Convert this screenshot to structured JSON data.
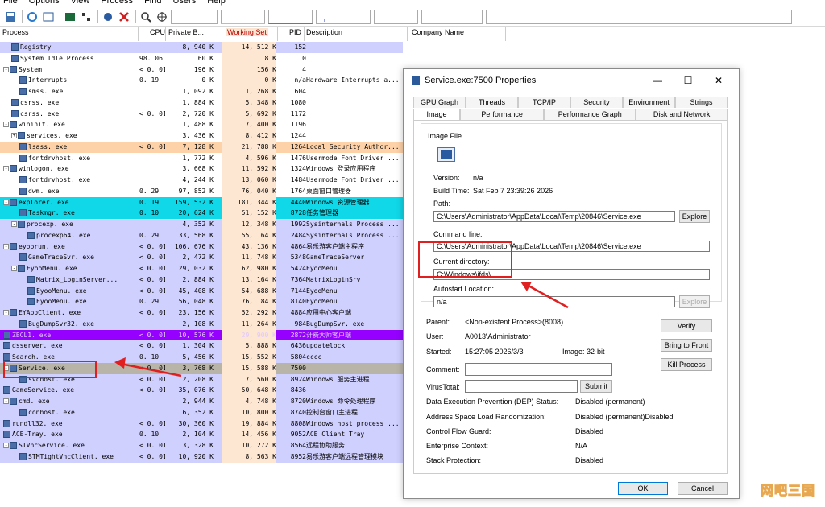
{
  "menu": [
    "File",
    "Options",
    "View",
    "Process",
    "Find",
    "Users",
    "Help"
  ],
  "columns": {
    "process": "Process",
    "cpu": "CPU",
    "private": "Private B...",
    "working": "Working Set",
    "pid": "PID",
    "description": "Description",
    "company": "Company Name"
  },
  "rows": [
    {
      "name": "Registry",
      "cpu": "",
      "pb": "8, 940 K",
      "ws": "14, 512 K",
      "pid": "152",
      "desc": "",
      "bg": "purple",
      "indent": 1
    },
    {
      "name": "System Idle Process",
      "cpu": "98. 06",
      "pb": "60 K",
      "ws": "8 K",
      "pid": "0",
      "desc": "",
      "bg": "",
      "indent": 1
    },
    {
      "name": "System",
      "cpu": "< 0. 01",
      "pb": "196 K",
      "ws": "156 K",
      "pid": "4",
      "desc": "",
      "bg": "",
      "indent": 0,
      "exp": "-"
    },
    {
      "name": "Interrupts",
      "cpu": "0. 19",
      "pb": "0 K",
      "ws": "0 K",
      "pid": "n/a",
      "desc": "Hardware Interrupts a...",
      "bg": "",
      "indent": 2
    },
    {
      "name": "smss. exe",
      "cpu": "",
      "pb": "1, 092 K",
      "ws": "1, 268 K",
      "pid": "604",
      "desc": "",
      "bg": "",
      "indent": 2
    },
    {
      "name": "csrss. exe",
      "cpu": "",
      "pb": "1, 884 K",
      "ws": "5, 348 K",
      "pid": "1080",
      "desc": "",
      "bg": "",
      "indent": 1
    },
    {
      "name": "csrss. exe",
      "cpu": "< 0. 01",
      "pb": "2, 720 K",
      "ws": "5, 692 K",
      "pid": "1172",
      "desc": "",
      "bg": "",
      "indent": 1
    },
    {
      "name": "wininit. exe",
      "cpu": "",
      "pb": "1, 488 K",
      "ws": "7, 400 K",
      "pid": "1196",
      "desc": "",
      "bg": "",
      "indent": 0,
      "exp": "-"
    },
    {
      "name": "services. exe",
      "cpu": "",
      "pb": "3, 436 K",
      "ws": "8, 412 K",
      "pid": "1244",
      "desc": "",
      "bg": "",
      "indent": 1,
      "exp": "+"
    },
    {
      "name": "lsass. exe",
      "cpu": "< 0. 01",
      "pb": "7, 128 K",
      "ws": "21, 788 K",
      "pid": "1264",
      "desc": "Local Security Author...",
      "bg": "orange",
      "indent": 2
    },
    {
      "name": "fontdrvhost. exe",
      "cpu": "",
      "pb": "1, 772 K",
      "ws": "4, 596 K",
      "pid": "1476",
      "desc": "Usermode Font Driver ...",
      "bg": "",
      "indent": 2
    },
    {
      "name": "winlogon. exe",
      "cpu": "",
      "pb": "3, 668 K",
      "ws": "11, 592 K",
      "pid": "1324",
      "desc": "Windows 登录应用程序",
      "bg": "",
      "indent": 0,
      "exp": "-"
    },
    {
      "name": "fontdrvhost. exe",
      "cpu": "",
      "pb": "4, 244 K",
      "ws": "13, 060 K",
      "pid": "1484",
      "desc": "Usermode Font Driver ...",
      "bg": "",
      "indent": 2
    },
    {
      "name": "dwm. exe",
      "cpu": "0. 29",
      "pb": "97, 852 K",
      "ws": "76, 040 K",
      "pid": "1764",
      "desc": "桌面窗口管理器",
      "bg": "",
      "indent": 2
    },
    {
      "name": "explorer. exe",
      "cpu": "0. 19",
      "pb": "159, 532 K",
      "ws": "181, 344 K",
      "pid": "4440",
      "desc": "Windows 资源管理器",
      "bg": "cyan",
      "indent": 0,
      "exp": "-"
    },
    {
      "name": "Taskmgr. exe",
      "cpu": "0. 10",
      "pb": "20, 624 K",
      "ws": "51, 152 K",
      "pid": "8728",
      "desc": "任务管理器",
      "bg": "cyan",
      "indent": 2
    },
    {
      "name": "procexp. exe",
      "cpu": "",
      "pb": "4, 352 K",
      "ws": "12, 348 K",
      "pid": "1992",
      "desc": "Sysinternals Process ...",
      "bg": "purple",
      "indent": 1,
      "exp": "-"
    },
    {
      "name": "procexp64. exe",
      "cpu": "0. 29",
      "pb": "33, 568 K",
      "ws": "55, 164 K",
      "pid": "2484",
      "desc": "Sysinternals Process ...",
      "bg": "purple",
      "indent": 3
    },
    {
      "name": "eyoorun. exe",
      "cpu": "< 0. 01",
      "pb": "106, 676 K",
      "ws": "43, 136 K",
      "pid": "4864",
      "desc": "易乐游客户端主程序",
      "bg": "purple",
      "indent": 0,
      "exp": "-"
    },
    {
      "name": "GameTraceSvr. exe",
      "cpu": "< 0. 01",
      "pb": "2, 472 K",
      "ws": "11, 748 K",
      "pid": "5348",
      "desc": "GameTraceServer",
      "bg": "purple",
      "indent": 2
    },
    {
      "name": "EyooMenu. exe",
      "cpu": "< 0. 01",
      "pb": "29, 032 K",
      "ws": "62, 980 K",
      "pid": "5424",
      "desc": "EyooMenu",
      "bg": "purple",
      "indent": 1,
      "exp": "-"
    },
    {
      "name": "Matrix_LoginServer...",
      "cpu": "< 0. 01",
      "pb": "2, 884 K",
      "ws": "13, 164 K",
      "pid": "7364",
      "desc": "MatrixLoginSrv",
      "bg": "purple",
      "indent": 3
    },
    {
      "name": "EyooMenu. exe",
      "cpu": "< 0. 01",
      "pb": "45, 408 K",
      "ws": "54, 688 K",
      "pid": "7144",
      "desc": "EyooMenu",
      "bg": "purple",
      "indent": 3
    },
    {
      "name": "EyooMenu. exe",
      "cpu": "0. 29",
      "pb": "56, 048 K",
      "ws": "76, 184 K",
      "pid": "8140",
      "desc": "EyooMenu",
      "bg": "purple",
      "indent": 3
    },
    {
      "name": "EYAppClient. exe",
      "cpu": "< 0. 01",
      "pb": "23, 156 K",
      "ws": "52, 292 K",
      "pid": "4884",
      "desc": "应用中心客户端",
      "bg": "purple",
      "indent": 0,
      "exp": "-"
    },
    {
      "name": "BugDumpSvr32. exe",
      "cpu": "",
      "pb": "2, 108 K",
      "ws": "11, 264 K",
      "pid": "984",
      "desc": "BugDumpSvr. exe",
      "bg": "purple",
      "indent": 2
    },
    {
      "name": "ZBCL1. exe",
      "cpu": "< 0. 01",
      "pb": "10, 576 K",
      "ws": "29, 900 K",
      "pid": "2872",
      "desc": "计费大师客户端",
      "bg": "violet",
      "indent": 0
    },
    {
      "name": "dsserver. exe",
      "cpu": "< 0. 01",
      "pb": "1, 304 K",
      "ws": "5, 888 K",
      "pid": "6436",
      "desc": "updatelock",
      "bg": "purple",
      "indent": 0
    },
    {
      "name": "Search. exe",
      "cpu": "0. 10",
      "pb": "5, 456 K",
      "ws": "15, 552 K",
      "pid": "5804",
      "desc": "cccc",
      "bg": "purple",
      "indent": 0
    },
    {
      "name": "Service. exe",
      "cpu": "< 0. 01",
      "pb": "3, 768 K",
      "ws": "15, 588 K",
      "pid": "7500",
      "desc": "",
      "bg": "gray",
      "indent": 0,
      "exp": "-"
    },
    {
      "name": "svchost. exe",
      "cpu": "< 0. 01",
      "pb": "2, 208 K",
      "ws": "7, 560 K",
      "pid": "8924",
      "desc": "Windows 服务主进程",
      "bg": "purple",
      "indent": 2
    },
    {
      "name": "GameService. exe",
      "cpu": "< 0. 01",
      "pb": "35, 076 K",
      "ws": "50, 648 K",
      "pid": "8436",
      "desc": "",
      "bg": "purple",
      "indent": 0
    },
    {
      "name": "cmd. exe",
      "cpu": "",
      "pb": "2, 944 K",
      "ws": "4, 748 K",
      "pid": "8720",
      "desc": "Windows 命令处理程序",
      "bg": "purple",
      "indent": 0,
      "exp": "-"
    },
    {
      "name": "conhost. exe",
      "cpu": "",
      "pb": "6, 352 K",
      "ws": "10, 800 K",
      "pid": "8740",
      "desc": "控制台窗口主进程",
      "bg": "purple",
      "indent": 2
    },
    {
      "name": "rundll32. exe",
      "cpu": "< 0. 01",
      "pb": "30, 360 K",
      "ws": "19, 884 K",
      "pid": "8808",
      "desc": "Windows host process ...",
      "bg": "purple",
      "indent": 0
    },
    {
      "name": "ACE-Tray. exe",
      "cpu": "0. 10",
      "pb": "2, 104 K",
      "ws": "14, 456 K",
      "pid": "9052",
      "desc": "ACE Client Tray",
      "bg": "purple",
      "indent": 0
    },
    {
      "name": "STVncService. exe",
      "cpu": "< 0. 01",
      "pb": "3, 328 K",
      "ws": "10, 272 K",
      "pid": "8564",
      "desc": "远程协助服务",
      "bg": "purple",
      "indent": 0,
      "exp": "-"
    },
    {
      "name": "STMTightVncClient. exe",
      "cpu": "< 0. 01",
      "pb": "10, 920 K",
      "ws": "8, 563 K",
      "pid": "8952",
      "desc": "易乐游客户端远程管理模块",
      "bg": "purple",
      "indent": 2
    }
  ],
  "dialog": {
    "title": "Service.exe:7500 Properties",
    "tabs_row1": [
      "GPU Graph",
      "Threads",
      "TCP/IP",
      "Security",
      "Environment",
      "Strings"
    ],
    "tabs_row2": [
      "Image",
      "Performance",
      "Performance Graph",
      "Disk and Network"
    ],
    "image_file_label": "Image File",
    "version_label": "Version:",
    "version_value": "n/a",
    "build_label": "Build Time:",
    "build_value": "Sat Feb  7 23:39:26 2026",
    "path_label": "Path:",
    "path_value": "C:\\Users\\Administrator\\AppData\\Local\\Temp\\20846\\Service.exe",
    "explore_label": "Explore",
    "cmdline_label": "Command line:",
    "cmdline_value": "C:\\Users\\Administrator\\AppData\\Local\\Temp\\20846\\Service.exe",
    "curdir_label": "Current directory:",
    "curdir_value": "C:\\Windows\\jfds\\",
    "autostart_label": "Autostart Location:",
    "autostart_value": "n/a",
    "parent_label": "Parent:",
    "parent_value": "<Non-existent Process>(8008)",
    "user_label": "User:",
    "user_value": "A0013\\Administrator",
    "started_label": "Started:",
    "started_value": "15:27:05  2026/3/3",
    "image_bits": "Image: 32-bit",
    "verify_label": "Verify",
    "bringfront_label": "Bring to Front",
    "kill_label": "Kill Process",
    "comment_label": "Comment:",
    "virustotal_label": "VirusTotal:",
    "submit_label": "Submit",
    "dep_label": "Data Execution Prevention (DEP) Status:",
    "dep_value": "Disabled (permanent)",
    "aslr_label": "Address Space Load Randomization:",
    "aslr_value": "Disabled (permanent)Disabled",
    "cfg_label": "Control Flow Guard:",
    "cfg_value": "Disabled",
    "enclave_label": "Enterprise Context:",
    "enclave_value": "N/A",
    "stack_label": "Stack Protection:",
    "stack_value": "Disabled",
    "ok_label": "OK",
    "cancel_label": "Cancel"
  },
  "watermark": "网吧三国",
  "colors": {
    "purple": "#d0d0ff",
    "cyan": "#10d8e8",
    "orange": "#fdd2a8",
    "gray": "#b8b4a8",
    "violet": "#9600ff",
    "annotation": "#e02020"
  }
}
